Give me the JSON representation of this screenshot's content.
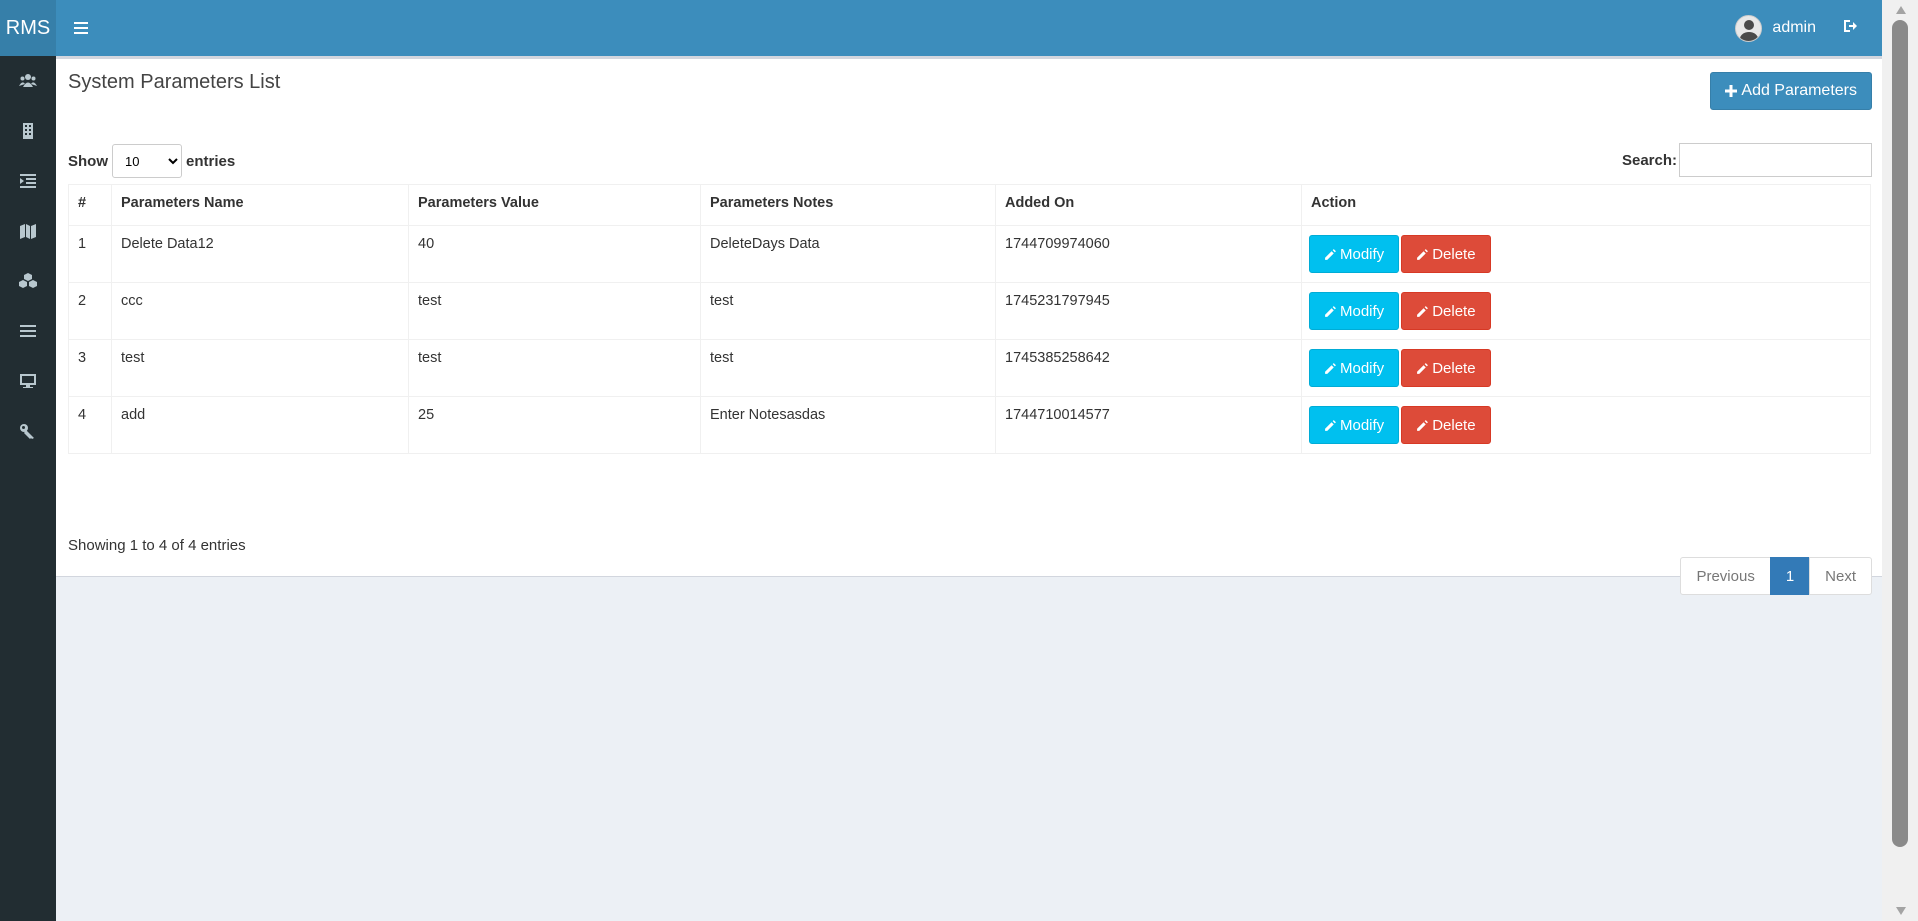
{
  "header": {
    "logo": "RMS",
    "username": "admin",
    "menu_icon": "bars-icon",
    "logout_icon": "sign-out-icon"
  },
  "sidebar": {
    "items": [
      {
        "icon": "users-icon"
      },
      {
        "icon": "building-icon"
      },
      {
        "icon": "indent-icon"
      },
      {
        "icon": "map-icon"
      },
      {
        "icon": "cubes-icon"
      },
      {
        "icon": "list-icon"
      },
      {
        "icon": "desktop-icon"
      },
      {
        "icon": "key-icon"
      }
    ]
  },
  "main": {
    "title": "System Parameters List",
    "add_button": "Add Parameters",
    "show_label": "Show",
    "entries_label": "entries",
    "page_size": "10",
    "search_label": "Search:",
    "search_value": ""
  },
  "table": {
    "headers": [
      "#",
      "Parameters Name",
      "Parameters Value",
      "Parameters Notes",
      "Added On",
      "Action"
    ],
    "rows": [
      {
        "num": "1",
        "name": "Delete Data12",
        "value": "40",
        "notes": "DeleteDays Data",
        "added": "1744709974060"
      },
      {
        "num": "2",
        "name": "ccc",
        "value": "test",
        "notes": "test",
        "added": "1745231797945"
      },
      {
        "num": "3",
        "name": "test",
        "value": "test",
        "notes": "test",
        "added": "1745385258642"
      },
      {
        "num": "4",
        "name": "add",
        "value": "25",
        "notes": "Enter Notesasdas",
        "added": "1744710014577"
      }
    ],
    "modify_label": "Modify",
    "delete_label": "Delete"
  },
  "footer": {
    "info": "Showing 1 to 4 of 4 entries",
    "previous": "Previous",
    "current_page": "1",
    "next": "Next"
  },
  "colors": {
    "header": "#3c8dbc",
    "sidebar": "#222d32",
    "modify": "#00c0ef",
    "delete": "#dd4b39",
    "active_page": "#337ab7"
  }
}
